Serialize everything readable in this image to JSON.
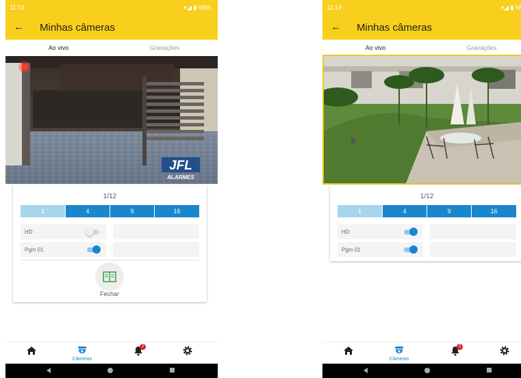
{
  "status_bar": {
    "time": "11:19",
    "battery": "68%"
  },
  "app_bar": {
    "title": "Minhas câmeras"
  },
  "tabs": {
    "live": "Ao vivo",
    "recordings": "Gravações"
  },
  "left_screen": {
    "camera_logo": {
      "brand": "JFL",
      "sub": "ALARMES"
    },
    "page_counter": "1/12",
    "layout_options": [
      "1",
      "4",
      "9",
      "16"
    ],
    "selected_layout": "1",
    "toggles": [
      {
        "label": "HD",
        "on": false
      },
      {
        "label": "Pgm 01",
        "on": true
      }
    ],
    "close_label": "Fechar"
  },
  "right_screen": {
    "page_counter": "1/12",
    "layout_options": [
      "1",
      "4",
      "9",
      "16"
    ],
    "selected_layout": "1",
    "toggles": [
      {
        "label": "HD",
        "on": true
      },
      {
        "label": "Pgm 01",
        "on": true
      }
    ]
  },
  "bottom_nav": {
    "cameras_label": "Câmeras",
    "notification_count": "2"
  },
  "colors": {
    "accent_yellow": "#f8cf1c",
    "primary_blue": "#1a86cc",
    "light_blue": "#a7d5ee"
  }
}
